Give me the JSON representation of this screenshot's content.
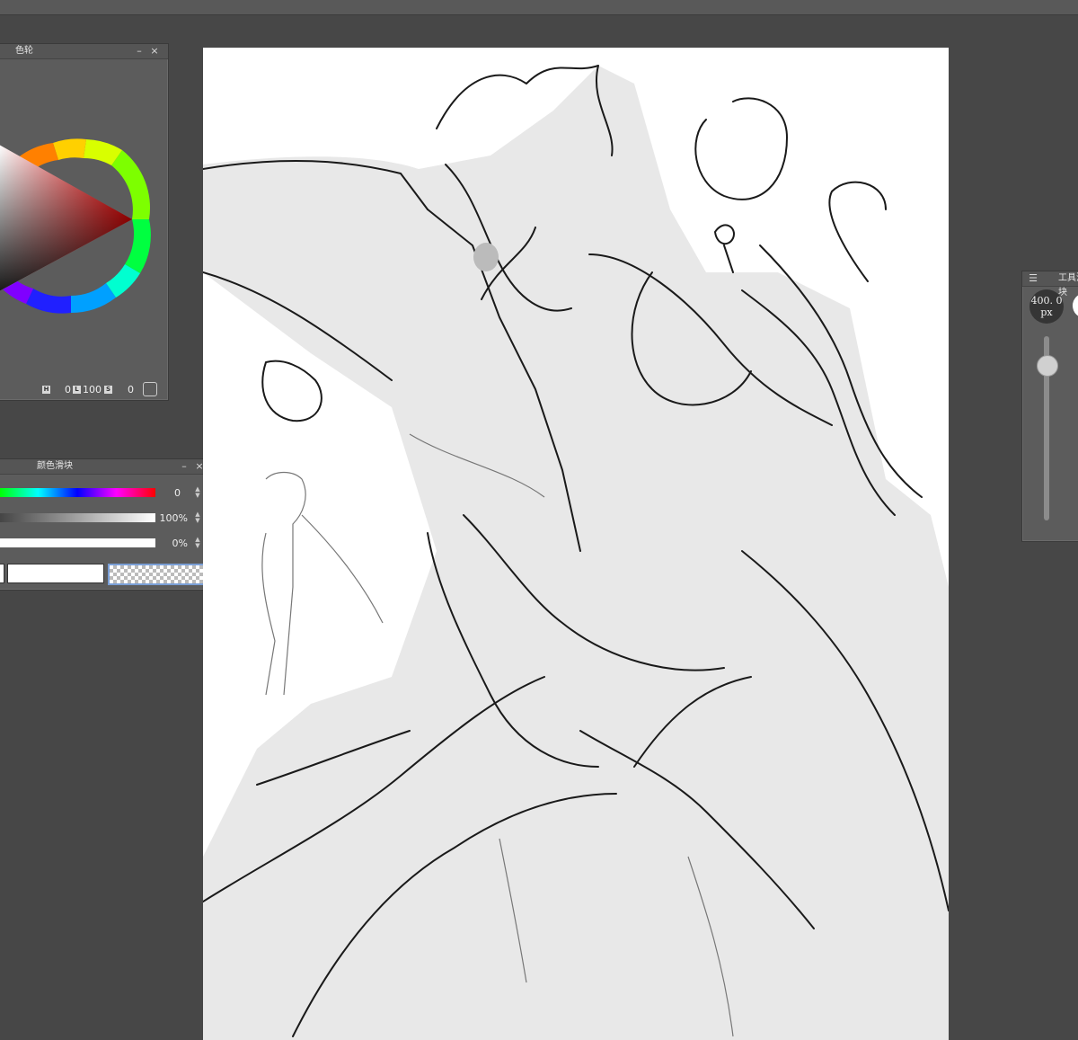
{
  "color_wheel_panel": {
    "title": "色轮",
    "h_label": "H",
    "h_value": "0",
    "l_label": "L",
    "l_value": "100",
    "s_label": "S",
    "s_value": "0"
  },
  "color_slider_panel": {
    "title": "颜色滑块",
    "hue_value": "0",
    "opacity_value": "100%",
    "third_value": "0%"
  },
  "tool_slider_panel": {
    "title": "工具滑块",
    "size_value": "400. 0",
    "size_unit": "px"
  },
  "colors": {
    "background": "#474747",
    "panel": "#5c5c5c",
    "canvas": "#ffffff"
  }
}
